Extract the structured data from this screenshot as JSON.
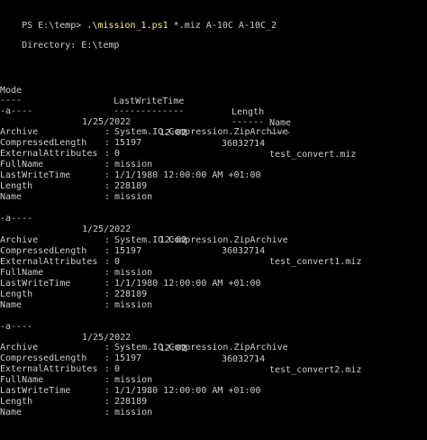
{
  "prompt": {
    "text": "PS E:\\temp> ",
    "script": ".\\mission_1.ps1",
    "args": " *.miz A-10C A-10C_2"
  },
  "directory_label": "    Directory: E:\\temp",
  "headers": {
    "mode": "Mode",
    "lastwrite": "LastWriteTime",
    "length": "Length",
    "name": "Name",
    "mode_dash": "----",
    "lastwrite_dash": "-------------",
    "length_dash": "------",
    "name_dash": "----"
  },
  "entries": [
    {
      "mode": "-a----",
      "date": "1/25/2022",
      "time": "12:02",
      "length": "36032714",
      "name": "test_convert.miz",
      "props": [
        {
          "key": "Archive",
          "val": "System.IO.Compression.ZipArchive"
        },
        {
          "key": "CompressedLength",
          "val": "15197"
        },
        {
          "key": "ExternalAttributes",
          "val": "0"
        },
        {
          "key": "FullName",
          "val": "mission"
        },
        {
          "key": "LastWriteTime",
          "val": "1/1/1980 12:00:00 AM +01:00"
        },
        {
          "key": "Length",
          "val": "228189"
        },
        {
          "key": "Name",
          "val": "mission"
        }
      ]
    },
    {
      "mode": "-a----",
      "date": "1/25/2022",
      "time": "12:02",
      "length": "36032714",
      "name": "test_convert1.miz",
      "props": [
        {
          "key": "Archive",
          "val": "System.IO.Compression.ZipArchive"
        },
        {
          "key": "CompressedLength",
          "val": "15197"
        },
        {
          "key": "ExternalAttributes",
          "val": "0"
        },
        {
          "key": "FullName",
          "val": "mission"
        },
        {
          "key": "LastWriteTime",
          "val": "1/1/1980 12:00:00 AM +01:00"
        },
        {
          "key": "Length",
          "val": "228189"
        },
        {
          "key": "Name",
          "val": "mission"
        }
      ]
    },
    {
      "mode": "-a----",
      "date": "1/25/2022",
      "time": "12:02",
      "length": "36032714",
      "name": "test_convert2.miz",
      "props": [
        {
          "key": "Archive",
          "val": "System.IO.Compression.ZipArchive"
        },
        {
          "key": "CompressedLength",
          "val": "15197"
        },
        {
          "key": "ExternalAttributes",
          "val": "0"
        },
        {
          "key": "FullName",
          "val": "mission"
        },
        {
          "key": "LastWriteTime",
          "val": "1/1/1980 12:00:00 AM +01:00"
        },
        {
          "key": "Length",
          "val": "228189"
        },
        {
          "key": "Name",
          "val": "mission"
        }
      ]
    }
  ],
  "prop_separator": ":"
}
